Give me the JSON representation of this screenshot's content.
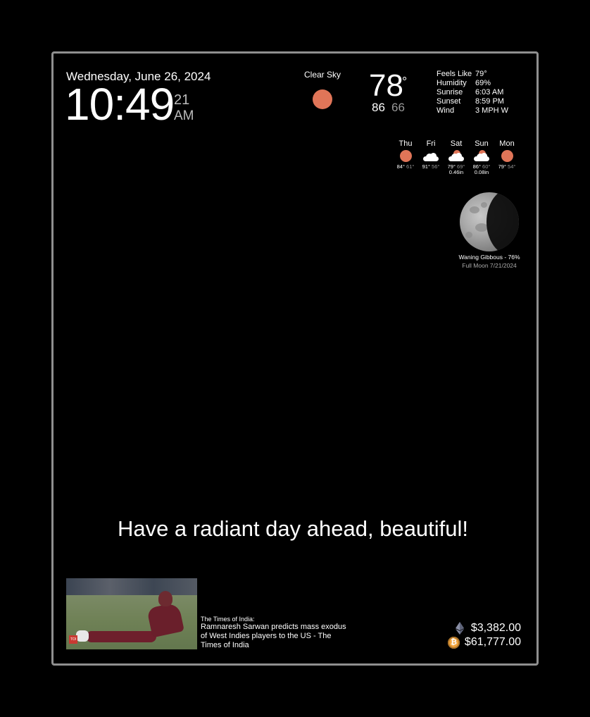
{
  "clock": {
    "date": "Wednesday, June 26, 2024",
    "time": "10:49",
    "seconds": "21",
    "ampm": "AM"
  },
  "current_weather": {
    "condition": "Clear Sky",
    "condition_icon": "sun-icon",
    "temp": "78",
    "degree": "°",
    "high": "86",
    "low": "66",
    "details": [
      {
        "label": "Feels Like",
        "value": "79°"
      },
      {
        "label": "Humidity",
        "value": "69%"
      },
      {
        "label": "Sunrise",
        "value": "6:03 AM"
      },
      {
        "label": "Sunset",
        "value": "8:59 PM"
      },
      {
        "label": "Wind",
        "value": "3 MPH W"
      }
    ]
  },
  "forecast": [
    {
      "day": "Thu",
      "high": "84°",
      "low": "61°",
      "rain": "",
      "icon": "sun-icon"
    },
    {
      "day": "Fri",
      "high": "91°",
      "low": "56°",
      "rain": "",
      "icon": "cloud-icon"
    },
    {
      "day": "Sat",
      "high": "79°",
      "low": "69°",
      "rain": "0.46in",
      "icon": "partly-cloudy-icon"
    },
    {
      "day": "Sun",
      "high": "86°",
      "low": "60°",
      "rain": "0.08in",
      "icon": "partly-cloudy-icon"
    },
    {
      "day": "Mon",
      "high": "79°",
      "low": "54°",
      "rain": "",
      "icon": "sun-icon"
    }
  ],
  "moon": {
    "phase": "Waning Gibbous - 76%",
    "next_full": "Full Moon 7/21/2024"
  },
  "compliment": "Have a radiant day ahead, beautiful!",
  "news": {
    "source": "The Times of India:",
    "headline": "Ramnaresh Sarwan predicts mass exodus of West Indies players to the US - The Times of India"
  },
  "crypto": [
    {
      "icon": "ethereum-icon",
      "value": "$3,382.00"
    },
    {
      "icon": "bitcoin-icon",
      "value": "$61,777.00"
    }
  ],
  "colors": {
    "accent_sun": "#e07558",
    "frame_border": "#8f8f8f",
    "muted_text": "#999999"
  }
}
